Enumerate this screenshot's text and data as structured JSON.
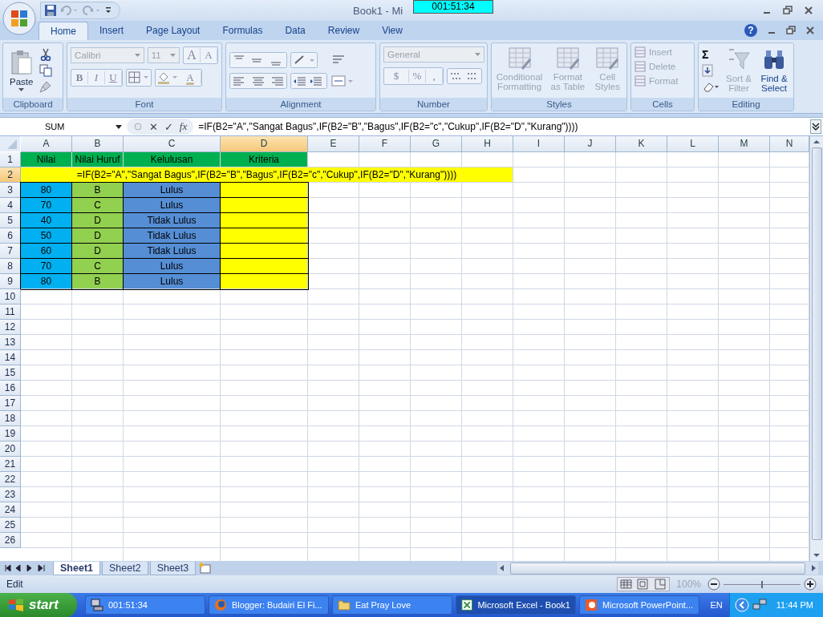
{
  "window": {
    "title": "Book1 - Mi",
    "timer": "001:51:34"
  },
  "tabs": [
    {
      "label": "Home",
      "selected": true
    },
    {
      "label": "Insert",
      "selected": false
    },
    {
      "label": "Page Layout",
      "selected": false
    },
    {
      "label": "Formulas",
      "selected": false
    },
    {
      "label": "Data",
      "selected": false
    },
    {
      "label": "Review",
      "selected": false
    },
    {
      "label": "View",
      "selected": false
    }
  ],
  "help": "?",
  "ribbon": {
    "clipboard": {
      "label": "Clipboard",
      "paste": "Paste"
    },
    "font": {
      "label": "Font",
      "font_name": "Calibri",
      "font_size": "11",
      "grow": "A",
      "shrink": "A",
      "bold": "B",
      "italic": "I",
      "underline": "U",
      "font_color": "A"
    },
    "alignment": {
      "label": "Alignment"
    },
    "number": {
      "label": "Number",
      "format": "General",
      "currency": "$",
      "percent": "%",
      "comma": ","
    },
    "styles": {
      "label": "Styles",
      "buttons": [
        {
          "label": "Conditional Formatting",
          "disabled": true
        },
        {
          "label": "Format as Table",
          "disabled": true
        },
        {
          "label": "Cell Styles",
          "disabled": true
        }
      ]
    },
    "cells": {
      "label": "Cells",
      "buttons": [
        {
          "label": "Insert",
          "disabled": true
        },
        {
          "label": "Delete",
          "disabled": true
        },
        {
          "label": "Format",
          "disabled": true
        }
      ]
    },
    "editing": {
      "label": "Editing",
      "sum": "Σ",
      "buttons": [
        {
          "label": "Sort & Filter",
          "disabled": true
        },
        {
          "label": "Find & Select",
          "disabled": false
        }
      ]
    }
  },
  "formula_bar": {
    "name_box": "SUM",
    "cancel": "✕",
    "enter": "✓",
    "fx": "fx",
    "formula": "=IF(B2=\"A\",\"Sangat Bagus\",IF(B2=\"B\",\"Bagus\",IF(B2=\"c\",\"Cukup\",IF(B2=\"D\",\"Kurang\"))))"
  },
  "sheet": {
    "columns": [
      {
        "label": "A",
        "selected": false
      },
      {
        "label": "B",
        "selected": false
      },
      {
        "label": "C",
        "selected": false
      },
      {
        "label": "D",
        "selected": true
      },
      {
        "label": "E",
        "selected": false
      },
      {
        "label": "F",
        "selected": false
      },
      {
        "label": "G",
        "selected": false
      },
      {
        "label": "H",
        "selected": false
      },
      {
        "label": "I",
        "selected": false
      },
      {
        "label": "J",
        "selected": false
      },
      {
        "label": "K",
        "selected": false
      },
      {
        "label": "L",
        "selected": false
      },
      {
        "label": "M",
        "selected": false
      },
      {
        "label": "N",
        "selected": false
      }
    ],
    "rows": [
      {
        "label": "1",
        "selected": false,
        "cells": [
          {
            "text": "Nilai",
            "color": "#00b050"
          },
          {
            "text": "Nilai Huruf",
            "color": "#00b050"
          },
          {
            "text": "Kelulusan",
            "color": "#00b050"
          },
          {
            "text": "Kriteria",
            "color": "#00b050"
          }
        ]
      },
      {
        "label": "2",
        "selected": true,
        "formula": "=IF(B2=\"A\",\"Sangat Bagus\",IF(B2=\"B\",\"Bagus\",IF(B2=\"c\",\"Cukup\",IF(B2=\"D\",\"Kurang\"))))",
        "color": "#ffff00"
      },
      {
        "label": "3",
        "selected": false,
        "cells": [
          {
            "text": "80",
            "color": "#00b0f0"
          },
          {
            "text": "B",
            "color": "#92d050"
          },
          {
            "text": "Lulus",
            "color": "#558ed5"
          },
          {
            "text": "",
            "color": "#ffff00"
          }
        ]
      },
      {
        "label": "4",
        "selected": false,
        "cells": [
          {
            "text": "70",
            "color": "#00b0f0"
          },
          {
            "text": "C",
            "color": "#92d050"
          },
          {
            "text": "Lulus",
            "color": "#558ed5"
          },
          {
            "text": "",
            "color": "#ffff00"
          }
        ]
      },
      {
        "label": "5",
        "selected": false,
        "cells": [
          {
            "text": "40",
            "color": "#00b0f0"
          },
          {
            "text": "D",
            "color": "#92d050"
          },
          {
            "text": "Tidak Lulus",
            "color": "#558ed5"
          },
          {
            "text": "",
            "color": "#ffff00"
          }
        ]
      },
      {
        "label": "6",
        "selected": false,
        "cells": [
          {
            "text": "50",
            "color": "#00b0f0"
          },
          {
            "text": "D",
            "color": "#92d050"
          },
          {
            "text": "Tidak Lulus",
            "color": "#558ed5"
          },
          {
            "text": "",
            "color": "#ffff00"
          }
        ]
      },
      {
        "label": "7",
        "selected": false,
        "cells": [
          {
            "text": "60",
            "color": "#00b0f0"
          },
          {
            "text": "D",
            "color": "#92d050"
          },
          {
            "text": "Tidak Lulus",
            "color": "#558ed5"
          },
          {
            "text": "",
            "color": "#ffff00"
          }
        ]
      },
      {
        "label": "8",
        "selected": false,
        "cells": [
          {
            "text": "70",
            "color": "#00b0f0"
          },
          {
            "text": "C",
            "color": "#92d050"
          },
          {
            "text": "Lulus",
            "color": "#558ed5"
          },
          {
            "text": "",
            "color": "#ffff00"
          }
        ]
      },
      {
        "label": "9",
        "selected": false,
        "cells": [
          {
            "text": "80",
            "color": "#00b0f0"
          },
          {
            "text": "B",
            "color": "#92d050"
          },
          {
            "text": "Lulus",
            "color": "#558ed5"
          },
          {
            "text": "",
            "color": "#ffff00"
          }
        ]
      },
      {
        "label": "10",
        "selected": false
      },
      {
        "label": "11",
        "selected": false
      },
      {
        "label": "12",
        "selected": false
      },
      {
        "label": "13",
        "selected": false
      },
      {
        "label": "14",
        "selected": false
      },
      {
        "label": "15",
        "selected": false
      },
      {
        "label": "16",
        "selected": false
      },
      {
        "label": "17",
        "selected": false
      },
      {
        "label": "18",
        "selected": false
      },
      {
        "label": "19",
        "selected": false
      },
      {
        "label": "20",
        "selected": false
      },
      {
        "label": "21",
        "selected": false
      },
      {
        "label": "22",
        "selected": false
      },
      {
        "label": "23",
        "selected": false
      },
      {
        "label": "24",
        "selected": false
      },
      {
        "label": "25",
        "selected": false
      },
      {
        "label": "26",
        "selected": false
      }
    ]
  },
  "sheet_tabs": [
    {
      "label": "Sheet1",
      "selected": true
    },
    {
      "label": "Sheet2",
      "selected": false
    },
    {
      "label": "Sheet3",
      "selected": false
    }
  ],
  "status_bar": {
    "mode": "Edit",
    "zoom": "100%",
    "zoom_slider": {
      "level": 0.5
    }
  },
  "taskbar": {
    "start": "start",
    "tasks": [
      {
        "label": "001:51:34",
        "selected": false
      },
      {
        "label": "Blogger: Budairi El Fi...",
        "selected": false
      },
      {
        "label": "Eat Pray Love",
        "selected": false
      },
      {
        "label": "Microsoft Excel - Book1",
        "selected": true
      },
      {
        "label": "Microsoft PowerPoint...",
        "selected": false
      }
    ],
    "language": "EN",
    "clock": "11:44 PM"
  }
}
